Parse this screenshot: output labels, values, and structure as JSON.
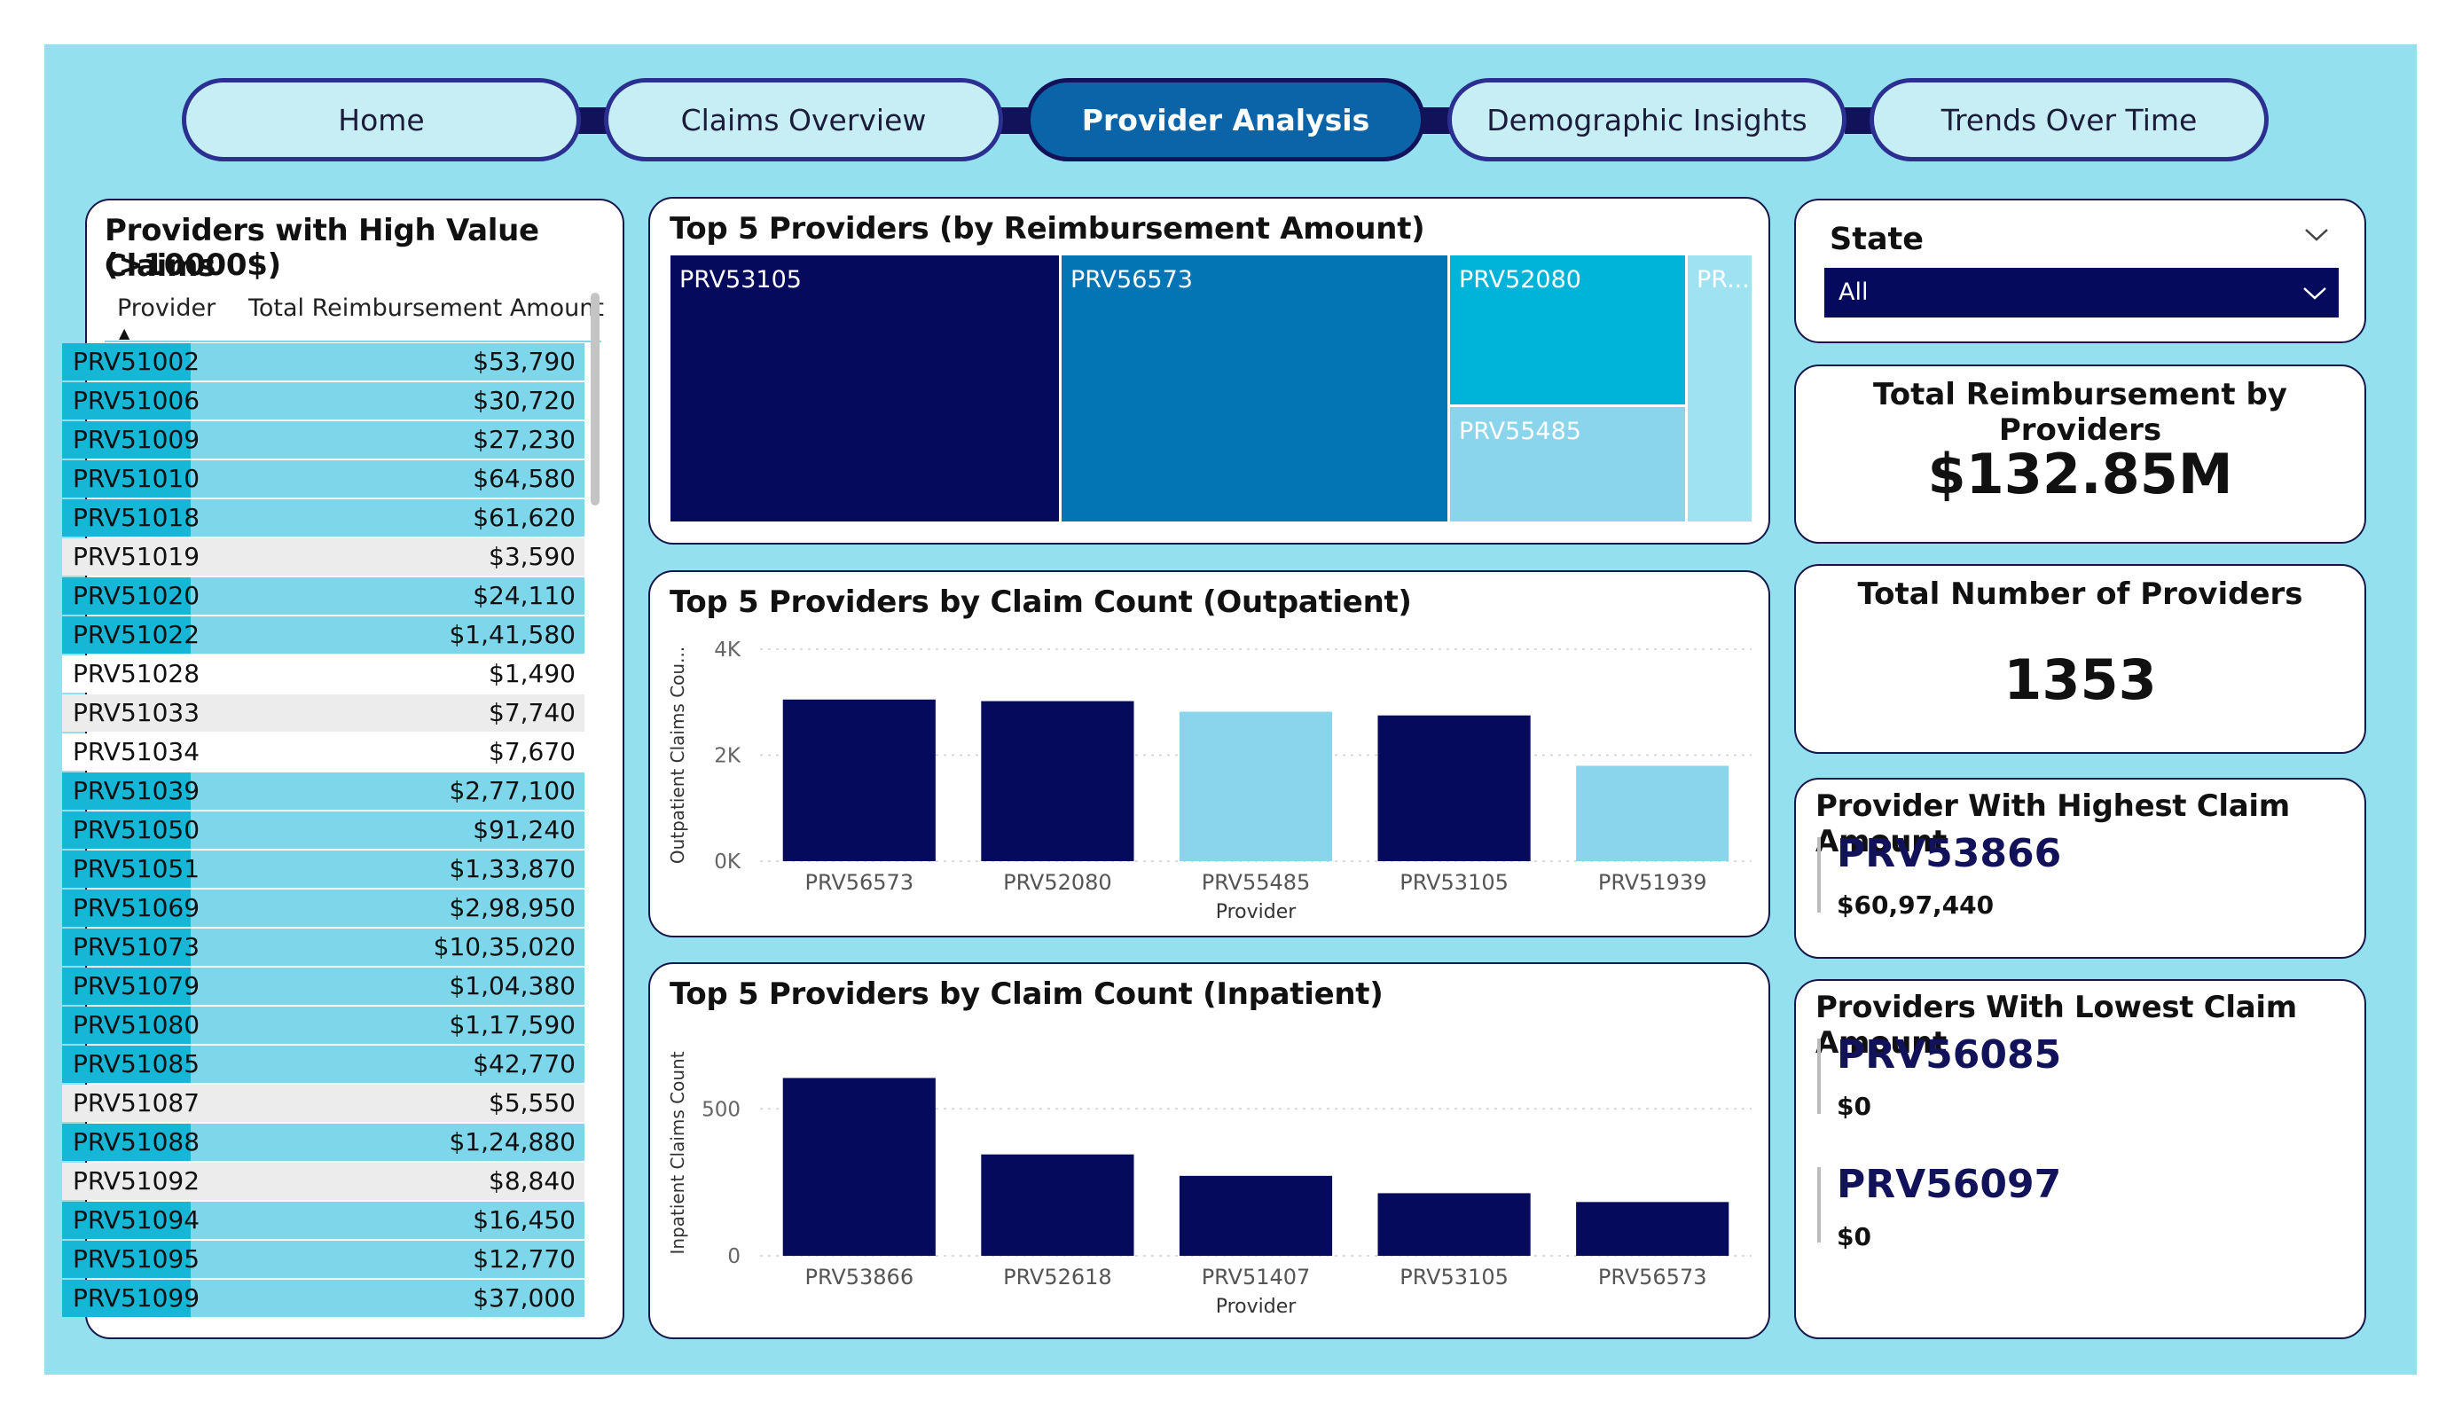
{
  "nav": {
    "tabs": [
      {
        "label": "Home",
        "active": false
      },
      {
        "label": "Claims Overview",
        "active": false
      },
      {
        "label": "Provider Analysis",
        "active": true
      },
      {
        "label": "Demographic Insights",
        "active": false
      },
      {
        "label": "Trends Over Time",
        "active": false
      }
    ]
  },
  "high_value": {
    "title_line1": "Providers with High Value Claims",
    "title_line2": "(>10000$)",
    "col_provider": "Provider",
    "col_amount": "Total Reimbursement Amount",
    "sort_indicator": "▲",
    "rows": [
      {
        "provider": "PRV51002",
        "amount": "$53,790",
        "highlight": true
      },
      {
        "provider": "PRV51006",
        "amount": "$30,720",
        "highlight": true
      },
      {
        "provider": "PRV51009",
        "amount": "$27,230",
        "highlight": true
      },
      {
        "provider": "PRV51010",
        "amount": "$64,580",
        "highlight": true
      },
      {
        "provider": "PRV51018",
        "amount": "$61,620",
        "highlight": true
      },
      {
        "provider": "PRV51019",
        "amount": "$3,590",
        "highlight": false
      },
      {
        "provider": "PRV51020",
        "amount": "$24,110",
        "highlight": true
      },
      {
        "provider": "PRV51022",
        "amount": "$1,41,580",
        "highlight": true
      },
      {
        "provider": "PRV51028",
        "amount": "$1,490",
        "highlight": false
      },
      {
        "provider": "PRV51033",
        "amount": "$7,740",
        "highlight": false
      },
      {
        "provider": "PRV51034",
        "amount": "$7,670",
        "highlight": false
      },
      {
        "provider": "PRV51039",
        "amount": "$2,77,100",
        "highlight": true
      },
      {
        "provider": "PRV51050",
        "amount": "$91,240",
        "highlight": true
      },
      {
        "provider": "PRV51051",
        "amount": "$1,33,870",
        "highlight": true
      },
      {
        "provider": "PRV51069",
        "amount": "$2,98,950",
        "highlight": true
      },
      {
        "provider": "PRV51073",
        "amount": "$10,35,020",
        "highlight": true
      },
      {
        "provider": "PRV51079",
        "amount": "$1,04,380",
        "highlight": true
      },
      {
        "provider": "PRV51080",
        "amount": "$1,17,590",
        "highlight": true
      },
      {
        "provider": "PRV51085",
        "amount": "$42,770",
        "highlight": true
      },
      {
        "provider": "PRV51087",
        "amount": "$5,550",
        "highlight": false
      },
      {
        "provider": "PRV51088",
        "amount": "$1,24,880",
        "highlight": true
      },
      {
        "provider": "PRV51092",
        "amount": "$8,840",
        "highlight": false
      },
      {
        "provider": "PRV51094",
        "amount": "$16,450",
        "highlight": true
      },
      {
        "provider": "PRV51095",
        "amount": "$12,770",
        "highlight": true
      },
      {
        "provider": "PRV51099",
        "amount": "$37,000",
        "highlight": true
      }
    ]
  },
  "treemap": {
    "title": "Top 5 Providers (by Reimbursement Amount)",
    "tiles": [
      {
        "label": "PRV53105",
        "color": "#050a5c"
      },
      {
        "label": "PRV56573",
        "color": "#0375b4"
      },
      {
        "label": "PRV52080",
        "color": "#00b3d9"
      },
      {
        "label": "PRV55485",
        "color": "#8bd5ec"
      },
      {
        "label": "PR...",
        "color": "#9fe2f2"
      }
    ]
  },
  "chart_data": [
    {
      "type": "bar",
      "title": "Top 5 Providers by Claim Count (Outpatient)",
      "xlabel": "Provider",
      "ylabel": "Outpatient Claims Cou...",
      "categories": [
        "PRV56573",
        "PRV52080",
        "PRV55485",
        "PRV53105",
        "PRV51939"
      ],
      "values": [
        3050,
        3020,
        2820,
        2750,
        1800
      ],
      "colors": [
        "#050a5c",
        "#050a5c",
        "#8bd5ec",
        "#050a5c",
        "#8bd5ec"
      ],
      "ylim": [
        0,
        4000
      ],
      "yticks": [
        0,
        2000,
        4000
      ],
      "yticklabels": [
        "0K",
        "2K",
        "4K"
      ],
      "grid": true
    },
    {
      "type": "bar",
      "title": "Top 5 Providers by Claim Count (Inpatient)",
      "xlabel": "Provider",
      "ylabel": "Inpatient Claims Count",
      "categories": [
        "PRV53866",
        "PRV52618",
        "PRV51407",
        "PRV53105",
        "PRV56573"
      ],
      "values": [
        605,
        345,
        272,
        213,
        183
      ],
      "colors": [
        "#050a5c",
        "#050a5c",
        "#050a5c",
        "#050a5c",
        "#050a5c"
      ],
      "ylim": [
        0,
        700
      ],
      "yticks": [
        0,
        500
      ],
      "yticklabels": [
        "0",
        "500"
      ],
      "grid": true
    }
  ],
  "slicer": {
    "title": "State",
    "selected": "All"
  },
  "kpi_total_reimbursement": {
    "title": "Total Reimbursement by Providers",
    "value": "$132.85M"
  },
  "kpi_total_providers": {
    "title": "Total Number of Providers",
    "value": "1353"
  },
  "highest": {
    "title": "Provider With Highest Claim Amount",
    "provider": "PRV53866",
    "amount": "$60,97,440"
  },
  "lowest": {
    "title": "Providers With Lowest Claim Amount",
    "items": [
      {
        "provider": "PRV56085",
        "amount": "$0"
      },
      {
        "provider": "PRV56097",
        "amount": "$0"
      }
    ]
  },
  "colors": {
    "background": "#94e0ee",
    "navy": "#050a5c",
    "highlight_row": "#7dd6ea",
    "highlight_cell": "#15b6d6"
  }
}
